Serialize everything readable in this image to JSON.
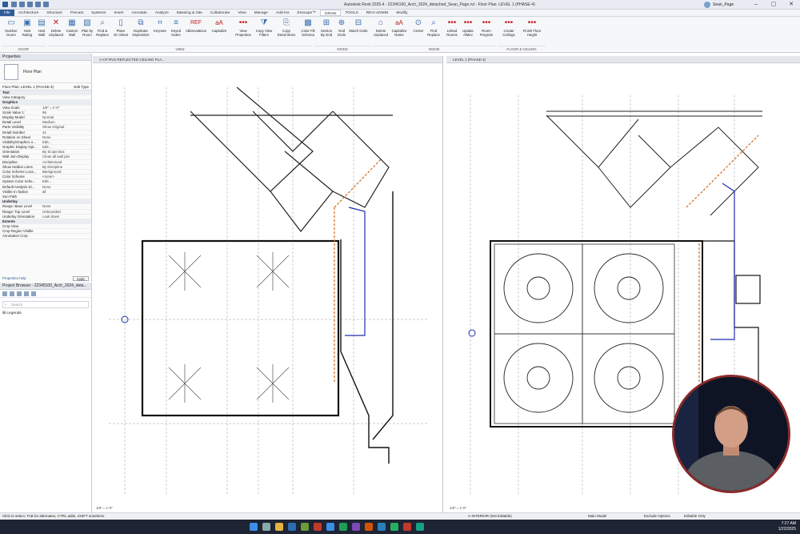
{
  "titlebar": {
    "title": "Autodesk Revit 2025.4 - 22345100_Arch_2024_detached_Sean_Page.rvt - Floor Plan: LEVEL 1 (PHASE-4)",
    "user": "Sean_Page"
  },
  "menu": [
    "File",
    "Architecture",
    "Structure",
    "Precast",
    "Systems",
    "Insert",
    "Annotate",
    "Analyze",
    "Massing & Site",
    "Collaborate",
    "View",
    "Manage",
    "Add-Ins",
    "Enscape™",
    "DRAW",
    "TOOLS",
    "REVI ADMIN",
    "Modify"
  ],
  "ribbon": {
    "buttons": [
      "Number\nDoors",
      "Host\nRating",
      "Host\nWall",
      "Delete\nUnplaced",
      "Custom\nWall",
      "Plan by\nRoom",
      "Find &\nReplace",
      "Place\nOn Sheet",
      "Duplicate\nDependent",
      "Keynote",
      "Keyed\nNotes",
      "Abbreviations",
      "Capitalize",
      "View\nProperties",
      "Copy View\nFilters",
      "Copy\nDetail Items",
      "Color Fill\nSchema",
      "Section\nBy Grid",
      "Grid\nEnds",
      "Match Grids",
      "Delete\nUnplaced",
      "Capitalize\nName",
      "Center",
      "Find\nReplace",
      "Linked\nRooms",
      "Update\nAlldev",
      "Room\nProgram",
      "Create\nCeilings",
      "Finish Floor\nHeight"
    ],
    "groups": [
      "DOOR",
      "VIEW",
      "GRIDS",
      "ROOM",
      "FLOOR & CEILING"
    ]
  },
  "properties": {
    "header": "Properties",
    "type_name": "Floor Plan",
    "instance": "Floor Plan: LEVEL 1 (PHASE-4)",
    "edit_type": "Edit Type",
    "rows": [
      [
        "Text",
        ""
      ],
      [
        "View Category",
        ""
      ],
      [
        "Graphics",
        ""
      ],
      [
        "View Scale",
        "1/8\" = 1'-0\""
      ],
      [
        "Scale Value  1:",
        "96"
      ],
      [
        "Display Model",
        "Normal"
      ],
      [
        "Detail Level",
        "Medium"
      ],
      [
        "Parts Visibility",
        "Show Original"
      ],
      [
        "Detail Number",
        "41"
      ],
      [
        "Rotation on Sheet",
        "None"
      ],
      [
        "Visibility/Graphics o...",
        "Edit..."
      ],
      [
        "Graphic Display Opt...",
        "Edit..."
      ],
      [
        "Orientation",
        "By Scope Box"
      ],
      [
        "Wall Join Display",
        "Clean all wall join"
      ],
      [
        "Discipline",
        "Architectural"
      ],
      [
        "Show Hidden Lines",
        "By Discipline"
      ],
      [
        "Color Scheme Loca...",
        "Background"
      ],
      [
        "Color Scheme",
        "<none>"
      ],
      [
        "System Color Sche...",
        "Edit..."
      ],
      [
        "Default Analysis Di...",
        "None"
      ],
      [
        "Visible In Option",
        "all"
      ],
      [
        "Sun Path",
        ""
      ],
      [
        "Underlay",
        ""
      ],
      [
        "Range: Base Level",
        "None"
      ],
      [
        "Range: Top Level",
        "Unbounded"
      ],
      [
        "Underlay Orientation",
        "Look down"
      ],
      [
        "Extents",
        ""
      ],
      [
        "Crop View",
        ""
      ],
      [
        "Crop Region Visible",
        ""
      ],
      [
        "Annotation Crop",
        ""
      ]
    ],
    "apply": "Apply",
    "help": "Properties help"
  },
  "browser": {
    "header": "Project Browser - 22345100_Arch_2024_deta...",
    "search_placeholder": "Search",
    "root": "Legends"
  },
  "views": {
    "left_tab": "A-CP RVS REFLECTED CEILING PLA...",
    "right_tab": "LEVEL 1 (PHASE-4)",
    "left_scale": "1/8\" = 1'-0\"",
    "right_scale": "1/8\" = 1'-0\""
  },
  "status": {
    "hint": "Click to select, TAB for alternates, CTRL adds, SHIFT unselects.",
    "workset": "A-INTERIOR (Not Editable)",
    "model": "Main Model",
    "exclude": "Exclude Options",
    "editable": "Editable Only"
  },
  "taskbar": {
    "time": "7:27 AM",
    "date": "1/22/2025"
  },
  "colors": {
    "accent": "#2e5c9a",
    "plan_orange": "#d2691e",
    "plan_blue": "#1f2fb0",
    "webcam_ring": "#8a2a2a"
  }
}
